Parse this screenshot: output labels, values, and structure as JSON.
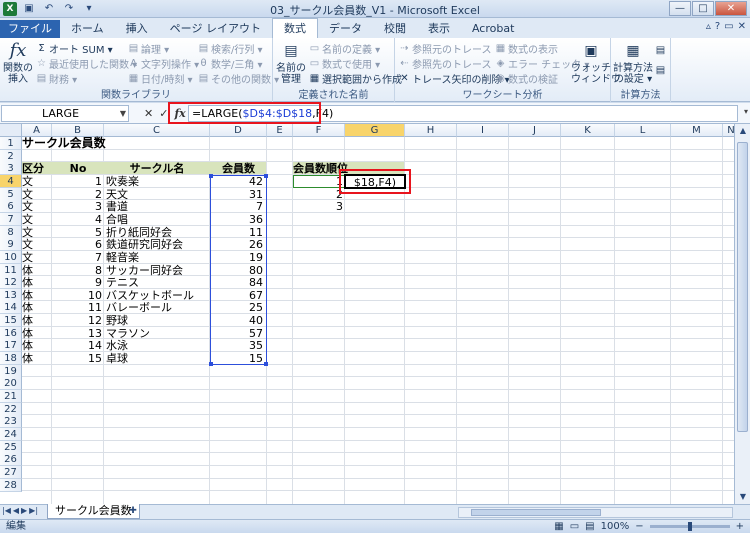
{
  "window": {
    "title": "03_サークル会員数_V1 - Microsoft Excel",
    "app_icon": "X",
    "qat": [
      "save-icon",
      "undo-icon",
      "redo-icon",
      "dropdown-icon"
    ],
    "controls": [
      "—",
      "□",
      "✕"
    ]
  },
  "ribbon": {
    "tabs": [
      "ファイル",
      "ホーム",
      "挿入",
      "ページ レイアウト",
      "数式",
      "データ",
      "校閲",
      "表示",
      "Acrobat"
    ],
    "active_tab": "数式",
    "groups": {
      "function_library": {
        "label": "関数ライブラリ",
        "insert_function": "関数の\n挿入",
        "items": [
          "オート SUM ▾",
          "最近使用した関数 ▾",
          "財務 ▾",
          "論理 ▾",
          "文字列操作 ▾",
          "日付/時刻 ▾",
          "検索/行列 ▾",
          "数学/三角 ▾",
          "その他の関数 ▾"
        ]
      },
      "defined_names": {
        "label": "定義された名前",
        "name_manager": "名前の\n管理",
        "items": [
          "名前の定義 ▾",
          "数式で使用 ▾",
          "選択範囲から作成"
        ]
      },
      "formula_auditing": {
        "label": "ワークシート分析",
        "items": [
          "参照元のトレース",
          "参照先のトレース",
          "トレース矢印の削除 ▾",
          "数式の表示",
          "エラー チェック ▾",
          "数式の検証"
        ],
        "watch": "ウォッチ\nウィンドウ"
      },
      "calculation": {
        "label": "計算方法",
        "options": "計算方法\nの設定 ▾"
      }
    }
  },
  "formula_bar": {
    "name_box": "LARGE",
    "formula_prefix": "=LARGE(",
    "formula_ref": "$D$4:$D$18",
    "formula_suffix": ",F4)"
  },
  "sheet": {
    "columns": [
      "A",
      "B",
      "C",
      "D",
      "E",
      "F",
      "G",
      "H",
      "I",
      "J",
      "K",
      "L",
      "M",
      "N"
    ],
    "rows": [
      "1",
      "2",
      "3",
      "4",
      "5",
      "6",
      "7",
      "8",
      "9",
      "10",
      "11",
      "12",
      "13",
      "14",
      "15",
      "16",
      "17",
      "18",
      "19",
      "20",
      "21",
      "22",
      "23",
      "24",
      "25",
      "26",
      "27",
      "28"
    ],
    "title": "サークル会員数",
    "headers": {
      "category": "区分",
      "no": "No",
      "circle": "サークル名",
      "members": "会員数",
      "rank": "会員数順位"
    },
    "records": [
      {
        "category": "文",
        "no": "1",
        "name": "吹奏楽",
        "members": "42"
      },
      {
        "category": "文",
        "no": "2",
        "name": "天文",
        "members": "31"
      },
      {
        "category": "文",
        "no": "3",
        "name": "書道",
        "members": "7"
      },
      {
        "category": "文",
        "no": "4",
        "name": "合唱",
        "members": "36"
      },
      {
        "category": "文",
        "no": "5",
        "name": "折り紙同好会",
        "members": "11"
      },
      {
        "category": "文",
        "no": "6",
        "name": "鉄道研究同好会",
        "members": "26"
      },
      {
        "category": "文",
        "no": "7",
        "name": "軽音楽",
        "members": "19"
      },
      {
        "category": "体",
        "no": "8",
        "name": "サッカー同好会",
        "members": "80"
      },
      {
        "category": "体",
        "no": "9",
        "name": "テニス",
        "members": "84"
      },
      {
        "category": "体",
        "no": "10",
        "name": "バスケットボール",
        "members": "67"
      },
      {
        "category": "体",
        "no": "11",
        "name": "バレーボール",
        "members": "25"
      },
      {
        "category": "体",
        "no": "12",
        "name": "野球",
        "members": "40"
      },
      {
        "category": "体",
        "no": "13",
        "name": "マラソン",
        "members": "57"
      },
      {
        "category": "体",
        "no": "14",
        "name": "水泳",
        "members": "35"
      },
      {
        "category": "体",
        "no": "15",
        "name": "卓球",
        "members": "15"
      }
    ],
    "ranks": [
      "1",
      "2",
      "3"
    ],
    "editing_cell_text": "$18,F4)"
  },
  "sheet_tabs": {
    "active": "サークル会員数"
  },
  "status": {
    "mode": "編集",
    "zoom": "100%"
  }
}
